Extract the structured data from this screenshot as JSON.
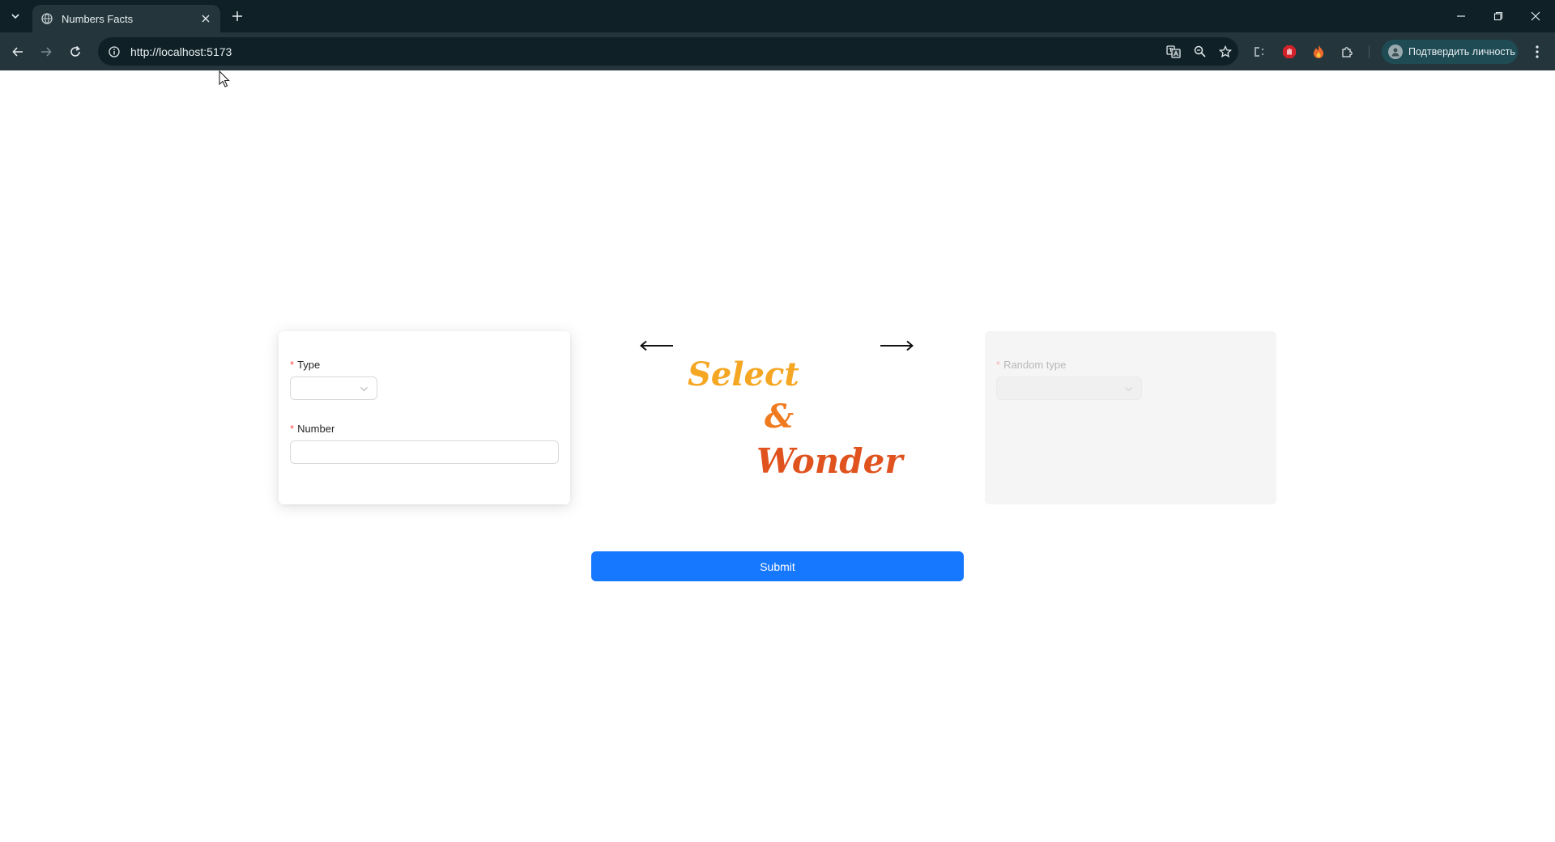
{
  "browser": {
    "tab": {
      "title": "Numbers Facts"
    },
    "address": {
      "url": "http://localhost:5173"
    },
    "profile": {
      "label": "Подтвердить личность"
    }
  },
  "form": {
    "type_field": {
      "label": "Type",
      "required_mark": "*",
      "value": ""
    },
    "number_field": {
      "label": "Number",
      "required_mark": "*",
      "value": ""
    },
    "random_type_field": {
      "label": "Random type",
      "required_mark": "*",
      "value": "",
      "disabled": true
    }
  },
  "hero": {
    "word1": "Select",
    "word2": "&",
    "word3": "Wonder",
    "left_arrow": "⟵",
    "right_arrow": "⟶"
  },
  "actions": {
    "submit_label": "Submit"
  },
  "colors": {
    "primary": "#1677ff",
    "required": "#ff4d4f",
    "select_text": "#f5a623",
    "amp_text": "#f07a1e",
    "wonder_text": "#e0531f",
    "chrome_dark": "#0f2127",
    "chrome_toolbar": "#24363c"
  },
  "icons": {
    "tab_search": "chevron-down-icon",
    "favicon": "globe-icon",
    "tab_close": "close-icon",
    "new_tab": "plus-icon",
    "back": "arrow-left-icon",
    "forward": "arrow-right-icon",
    "reload": "reload-icon",
    "site_info": "info-icon",
    "translate": "translate-icon",
    "zoom": "zoom-icon",
    "bookmark": "star-icon",
    "extensions": "puzzle-icon",
    "menu": "kebab-menu-icon"
  }
}
